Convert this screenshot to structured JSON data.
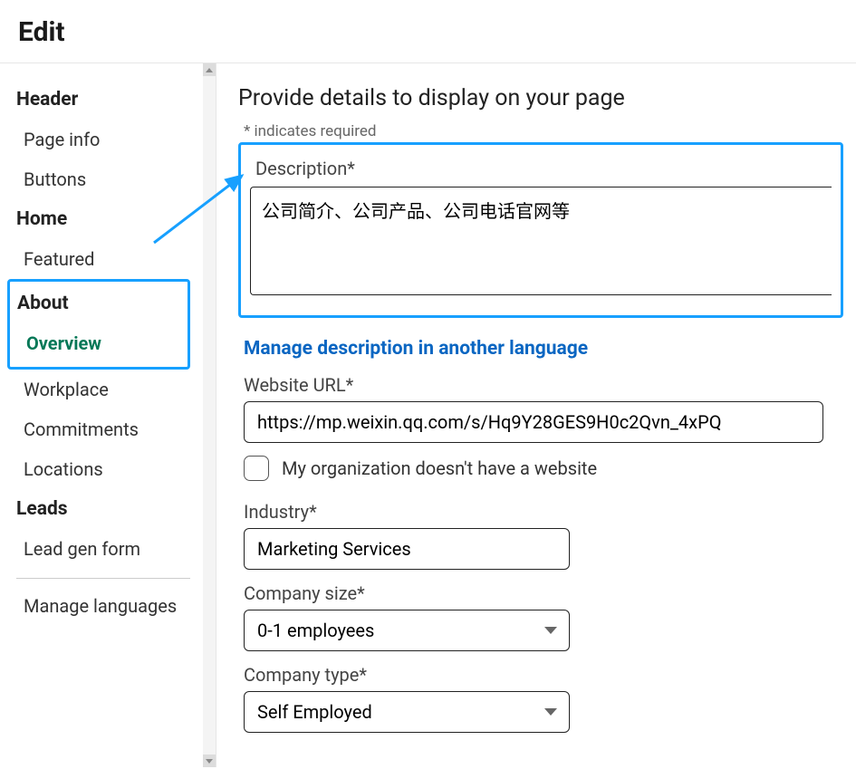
{
  "page": {
    "title": "Edit"
  },
  "sidebar": {
    "header": {
      "label": "Header"
    },
    "page_info": {
      "label": "Page info"
    },
    "buttons": {
      "label": "Buttons"
    },
    "home": {
      "label": "Home"
    },
    "featured": {
      "label": "Featured"
    },
    "about": {
      "label": "About"
    },
    "overview": {
      "label": "Overview"
    },
    "workplace": {
      "label": "Workplace"
    },
    "commitments": {
      "label": "Commitments"
    },
    "locations": {
      "label": "Locations"
    },
    "leads": {
      "label": "Leads"
    },
    "lead_gen_form": {
      "label": "Lead gen form"
    },
    "manage_languages": {
      "label": "Manage languages"
    }
  },
  "main": {
    "heading": "Provide details to display on your page",
    "required_hint": "* indicates required",
    "description": {
      "label": "Description*",
      "value": "公司简介、公司产品、公司电话官网等"
    },
    "manage_lang_link": "Manage description in another language",
    "website": {
      "label": "Website URL*",
      "value": "https://mp.weixin.qq.com/s/Hq9Y28GES9H0c2Qvn_4xPQ"
    },
    "no_website": {
      "label": "My organization doesn't have a website",
      "checked": false
    },
    "industry": {
      "label": "Industry*",
      "value": "Marketing Services"
    },
    "company_size": {
      "label": "Company size*",
      "value": "0-1 employees"
    },
    "company_type": {
      "label": "Company type*",
      "value": "Self Employed"
    }
  }
}
